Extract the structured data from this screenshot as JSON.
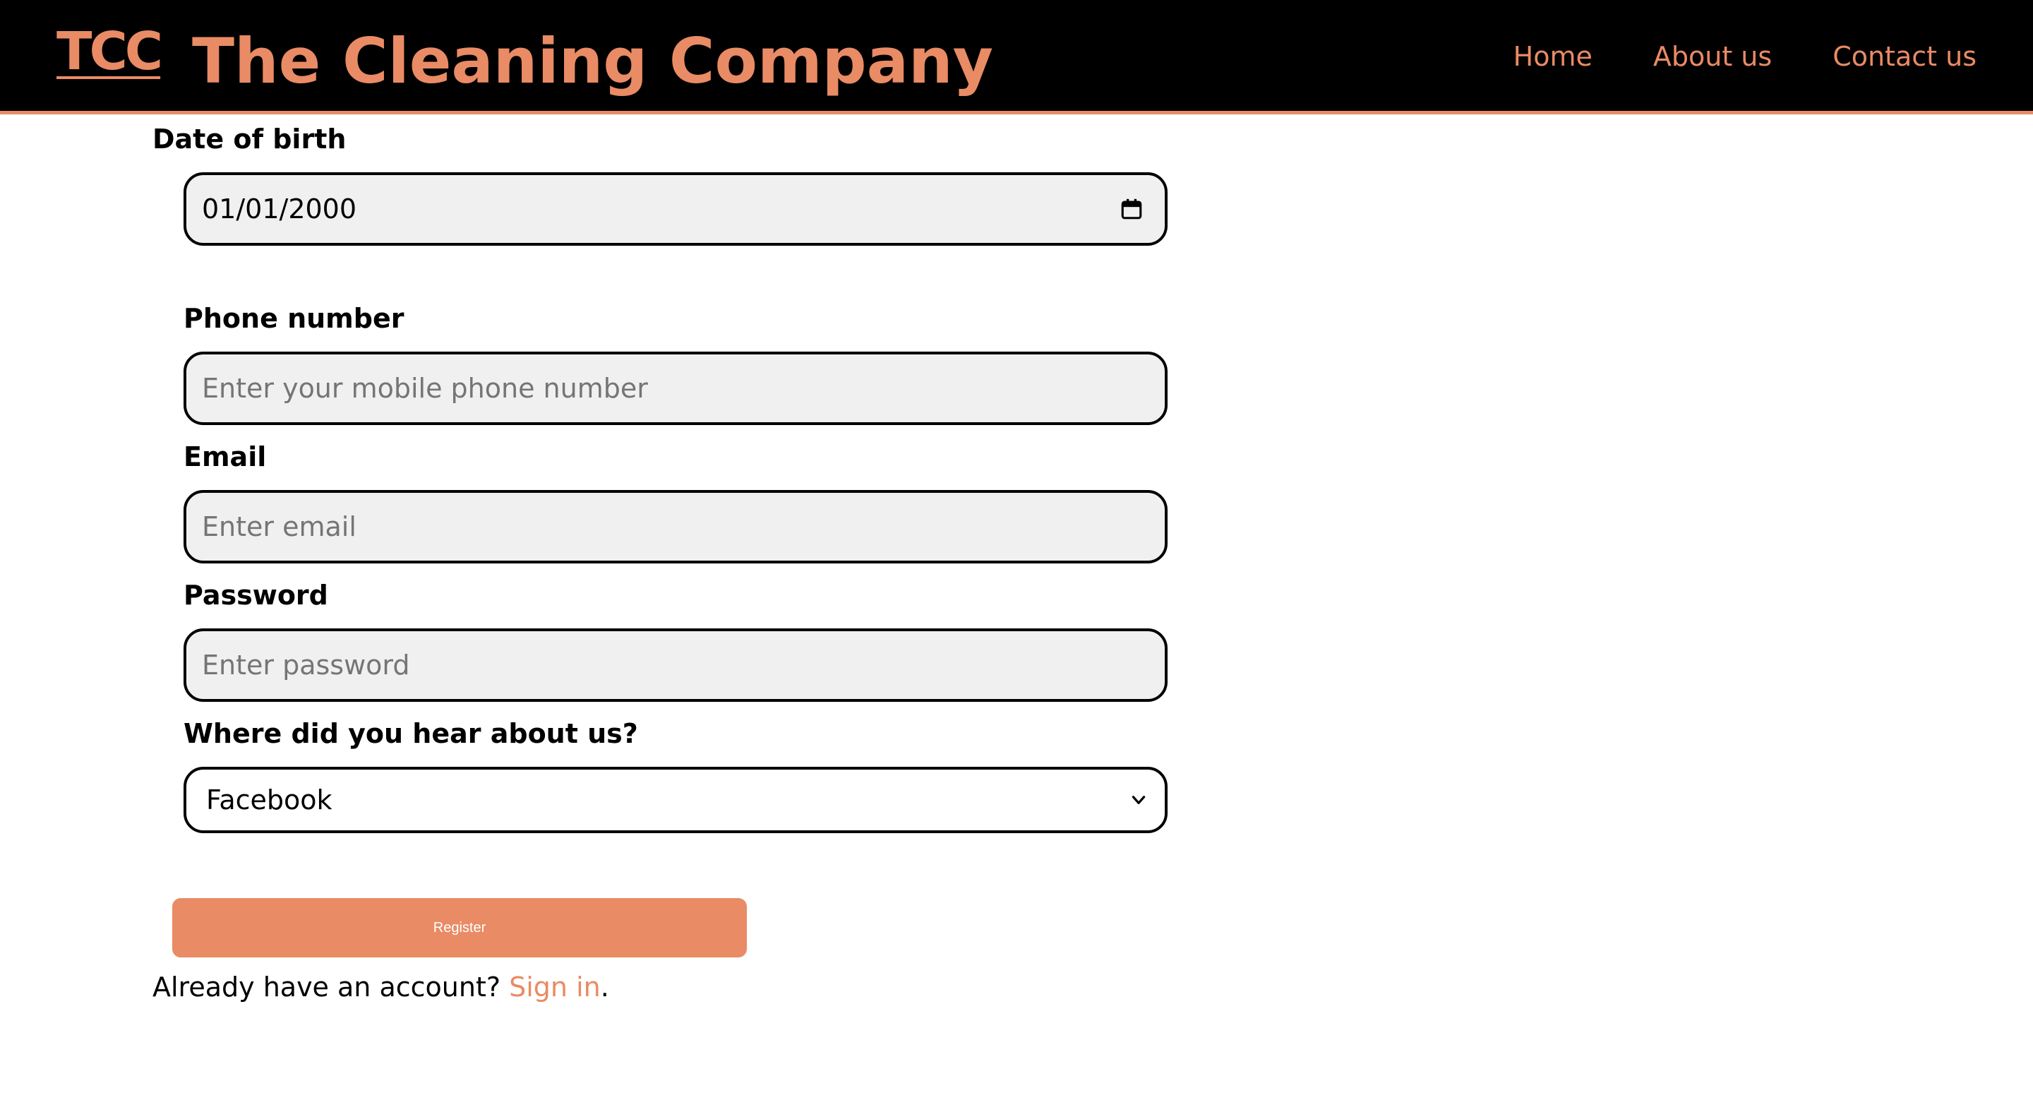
{
  "header": {
    "logo": "TCC",
    "title": "The Cleaning Company",
    "nav": [
      {
        "label": "Home"
      },
      {
        "label": "About us"
      },
      {
        "label": "Contact us"
      }
    ]
  },
  "form": {
    "dob": {
      "label": "Date of birth",
      "value": "01/01/2000"
    },
    "phone": {
      "label": "Phone number",
      "placeholder": "Enter your mobile phone number"
    },
    "email": {
      "label": "Email",
      "placeholder": "Enter email"
    },
    "password": {
      "label": "Password",
      "placeholder": "Enter password"
    },
    "source": {
      "label": "Where did you hear about us?",
      "selected": "Facebook"
    },
    "register_label": "Register",
    "signin_prefix": "Already have an account? ",
    "signin_link": "Sign in",
    "signin_suffix": "."
  },
  "colors": {
    "accent": "#e98b65",
    "header_bg": "#000000",
    "input_bg": "#f0f0f0"
  },
  "icons": {
    "dob": "calendar-icon",
    "source": "chevron-down-icon"
  }
}
